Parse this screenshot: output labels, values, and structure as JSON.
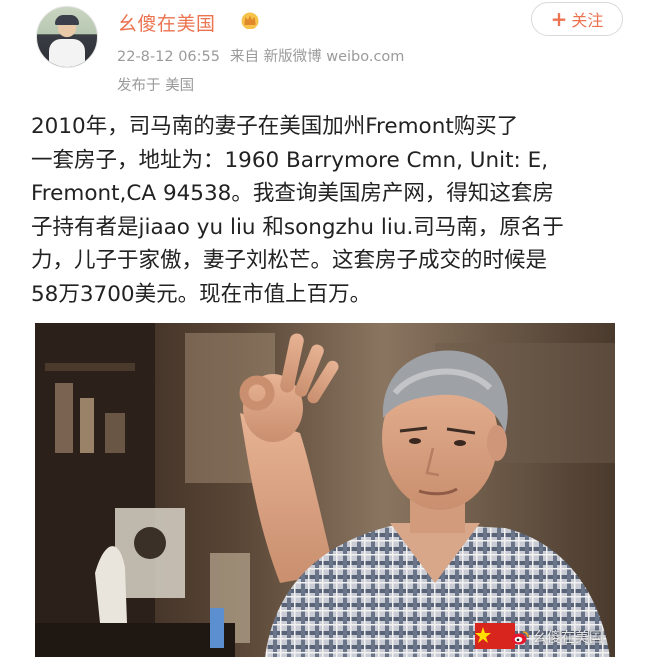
{
  "header": {
    "username": "幺傻在美国",
    "badge_icon": "crown-icon",
    "timestamp": "22-8-12 06:55",
    "source": "来自 新版微博 weibo.com",
    "location": "发布于 美国",
    "follow_label": "关注",
    "follow_plus": "+"
  },
  "post": {
    "lines": [
      "2010年，司马南的妻子在美国加州Fremont购买了",
      "一套房子，地址为：1960 Barrymore Cmn, Unit: E,",
      "Fremont,CA 94538。我查询美国房产网，得知这套房",
      "子持有者是jiaao yu liu 和songzhu liu.司马南，原名于",
      "力，儿子于家傲，妻子刘松芒。这套房子成交的时候是",
      "58万3700美元。现在市值上百万。"
    ]
  },
  "photo": {
    "watermark": "幺傻在美国",
    "watermark_icon": "weibo-logo-icon"
  },
  "colors": {
    "accent": "#eb7350",
    "meta": "#9a9a9a",
    "text": "#222222"
  }
}
